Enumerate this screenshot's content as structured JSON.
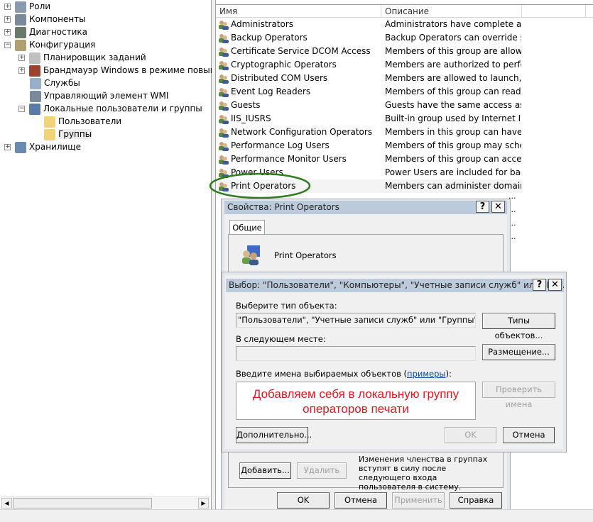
{
  "tree": {
    "items": [
      {
        "label": "Роли",
        "expander": "+"
      },
      {
        "label": "Компоненты",
        "expander": "+"
      },
      {
        "label": "Диагностика",
        "expander": "+"
      },
      {
        "label": "Конфигурация",
        "expander": "−"
      },
      {
        "label": "Планировщик заданий",
        "expander": "+"
      },
      {
        "label": "Брандмауэр Windows в режиме повышенн",
        "expander": "+"
      },
      {
        "label": "Службы",
        "expander": ""
      },
      {
        "label": "Управляющий элемент WMI",
        "expander": ""
      },
      {
        "label": "Локальные пользователи и группы",
        "expander": "−"
      },
      {
        "label": "Пользователи",
        "expander": ""
      },
      {
        "label": "Группы",
        "expander": ""
      },
      {
        "label": "Хранилище",
        "expander": "+"
      }
    ],
    "selected": "Группы"
  },
  "list": {
    "columns": [
      "Имя",
      "Описание",
      ""
    ],
    "rows": [
      {
        "name": "Administrators",
        "desc": "Administrators have complete an..."
      },
      {
        "name": "Backup Operators",
        "desc": "Backup Operators can override se..."
      },
      {
        "name": "Certificate Service DCOM Access",
        "desc": "Members of this group are allowe..."
      },
      {
        "name": "Cryptographic Operators",
        "desc": "Members are authorized to perfor..."
      },
      {
        "name": "Distributed COM Users",
        "desc": "Members are allowed to launch, a..."
      },
      {
        "name": "Event Log Readers",
        "desc": "Members of this group can read e..."
      },
      {
        "name": "Guests",
        "desc": "Guests have the same access as m..."
      },
      {
        "name": "IIS_IUSRS",
        "desc": "Built-in group used by Internet Inf..."
      },
      {
        "name": "Network Configuration Operators",
        "desc": "Members in this group can have s..."
      },
      {
        "name": "Performance Log Users",
        "desc": "Members of this group may sche..."
      },
      {
        "name": "Performance Monitor Users",
        "desc": "Members of this group can acces..."
      },
      {
        "name": "Power Users",
        "desc": "Power Users are included for back..."
      },
      {
        "name": "Print Operators",
        "desc": "Members can administer domain ..."
      }
    ],
    "hidden_row_ellipsis": "...",
    "highlight_color": "#2e7d1e"
  },
  "properties": {
    "title": "Свойства: Print Operators",
    "help": "?",
    "close": "✕",
    "tab": "Общие",
    "group_name": "Print Operators",
    "add": "Добавить...",
    "remove": "Удалить",
    "note": "Изменения членства в группах вступят в силу после следующего входа пользователя в систему.",
    "ok": "OK",
    "cancel": "Отмена",
    "apply": "Применить",
    "help_btn": "Справка"
  },
  "select": {
    "title": "Выбор: \"Пользователи\", \"Компьютеры\", \"Учетные записи служб\" или \"Гру...",
    "help": "?",
    "close": "✕",
    "type_label": "Выберите тип объекта:",
    "type_value": "\"Пользователи\", \"Учетные записи служб\" или \"Группы\"",
    "types_btn": "Типы объектов...",
    "location_label": "В следующем месте:",
    "location_value": "",
    "location_btn": "Размещение...",
    "names_label": "Введите имена выбираемых объектов (",
    "names_link": "примеры",
    "names_label_end": "):",
    "check_btn": "Проверить имена",
    "annotation": "Добавляем себя в локальную группу операторов печати",
    "annotation_color": "#e8141c",
    "advanced": "Дополнительно...",
    "ok": "OK",
    "cancel": "Отмена"
  }
}
